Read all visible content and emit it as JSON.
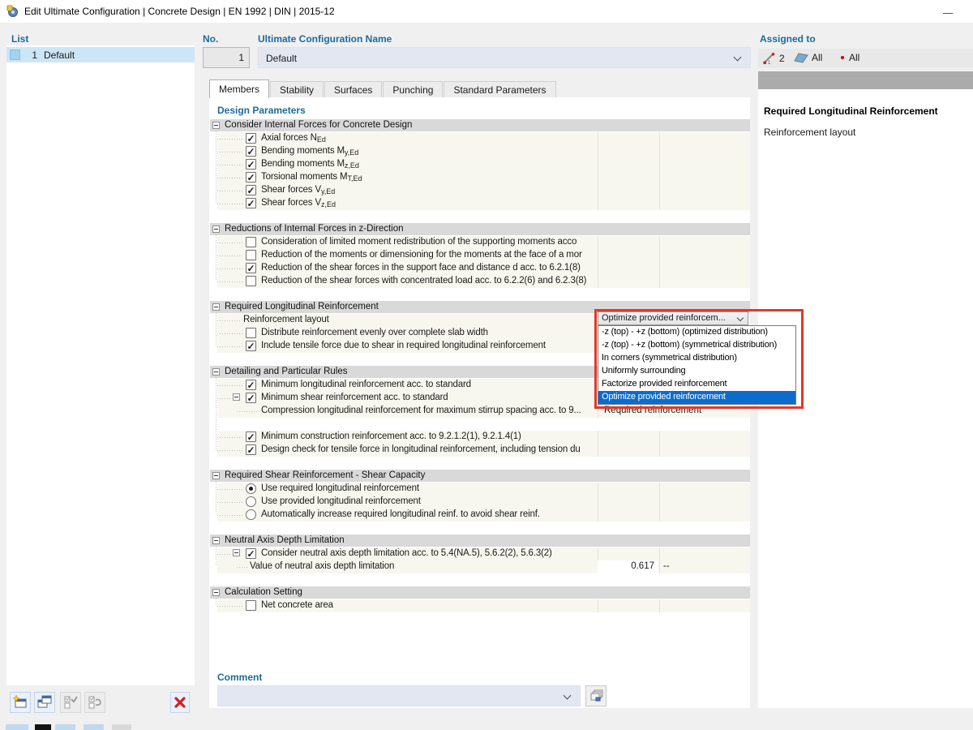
{
  "colors": {
    "accent_blue": "#1d6a9c",
    "selection_blue": "#0b6cce",
    "annotation_red": "#e0392b",
    "list_selection": "#cde6f7",
    "row_background": "#f7f7ef"
  },
  "window": {
    "title": "Edit Ultimate Configuration | Concrete Design | EN 1992 | DIN | 2015-12"
  },
  "list_panel": {
    "header": "List",
    "rows": [
      {
        "no": "1",
        "name": "Default"
      }
    ]
  },
  "config": {
    "no_label": "No.",
    "no_value": "1",
    "name_label": "Ultimate Configuration Name",
    "name_value": "Default"
  },
  "assigned": {
    "label": "Assigned to",
    "members": "2",
    "surfaces": "All",
    "points": "All"
  },
  "tabs": [
    {
      "label": "Members",
      "active": true
    },
    {
      "label": "Stability",
      "active": false
    },
    {
      "label": "Surfaces",
      "active": false
    },
    {
      "label": "Punching",
      "active": false
    },
    {
      "label": "Standard Parameters",
      "active": false
    }
  ],
  "params": {
    "header": "Design Parameters"
  },
  "right_panel": {
    "title": "Required Longitudinal Reinforcement",
    "subtitle": "Reinforcement layout"
  },
  "sections": [
    {
      "title": "Consider Internal Forces for Concrete Design",
      "rows": [
        {
          "checked": true,
          "label": "Axial forces N",
          "sub": "Ed"
        },
        {
          "checked": true,
          "label": "Bending moments M",
          "sub": "y,Ed"
        },
        {
          "checked": true,
          "label": "Bending moments M",
          "sub": "z,Ed"
        },
        {
          "checked": true,
          "label": "Torsional moments M",
          "sub": "T,Ed"
        },
        {
          "checked": true,
          "label": "Shear forces V",
          "sub": "y,Ed"
        },
        {
          "checked": true,
          "label": "Shear forces V",
          "sub": "z,Ed"
        }
      ]
    },
    {
      "title": "Reductions of Internal Forces in z-Direction",
      "rows": [
        {
          "checked": false,
          "label": "Consideration of limited moment redistribution of the supporting moments acco"
        },
        {
          "checked": false,
          "label": "Reduction of the moments or dimensioning for the moments at the face of a mor"
        },
        {
          "checked": true,
          "label": "Reduction of the shear forces in the support face and distance d acc. to 6.2.1(8)"
        },
        {
          "checked": false,
          "label": "Reduction of the shear forces with concentrated load acc. to 6.2.2(6) and 6.2.3(8)"
        }
      ]
    },
    {
      "title": "Required Longitudinal Reinforcement",
      "rows": [
        {
          "label": "Reinforcement layout"
        },
        {
          "checked": false,
          "label": "Distribute reinforcement evenly over complete slab width"
        },
        {
          "checked": true,
          "label": "Include tensile force due to shear in required longitudinal reinforcement"
        }
      ]
    },
    {
      "title": "Detailing and Particular Rules",
      "rows": [
        {
          "checked": true,
          "label": "Minimum longitudinal reinforcement acc. to standard"
        },
        {
          "checked": true,
          "label": "Minimum shear reinforcement acc. to standard"
        },
        {
          "label": "Compression longitudinal reinforcement for maximum stirrup spacing acc. to 9...",
          "value": "Required reinforcement"
        },
        {
          "checked": true,
          "label": "Minimum construction reinforcement acc. to 9.2.1.2(1), 9.2.1.4(1)"
        },
        {
          "checked": true,
          "label": "Design check for tensile force in longitudinal reinforcement, including tension du"
        }
      ]
    },
    {
      "title": "Required Shear Reinforcement - Shear Capacity",
      "rows": [
        {
          "checked": true,
          "label": "Use required longitudinal reinforcement"
        },
        {
          "checked": false,
          "label": "Use provided longitudinal reinforcement"
        },
        {
          "checked": false,
          "label": "Automatically increase required longitudinal reinf. to avoid shear reinf."
        }
      ]
    },
    {
      "title": "Neutral Axis Depth Limitation",
      "rows": [
        {
          "checked": true,
          "label": "Consider neutral axis depth limitation acc. to 5.4(NA.5), 5.6.2(2), 5.6.3(2)"
        },
        {
          "label": "Value of neutral axis depth limitation",
          "value": "0.617",
          "unit": "--"
        }
      ]
    },
    {
      "title": "Calculation Setting",
      "rows": [
        {
          "checked": false,
          "label": "Net concrete area"
        }
      ]
    }
  ],
  "dropdown": {
    "value": "Optimize provided reinforcem...",
    "items": [
      {
        "label": "-z (top) - +z (bottom) (optimized distribution)",
        "selected": false
      },
      {
        "label": "-z (top) - +z (bottom) (symmetrical distribution)",
        "selected": false
      },
      {
        "label": "In corners (symmetrical distribution)",
        "selected": false
      },
      {
        "label": "Uniformly surrounding",
        "selected": false
      },
      {
        "label": "Factorize provided reinforcement",
        "selected": false
      },
      {
        "label": "Optimize provided reinforcement",
        "selected": true
      }
    ]
  },
  "comment": {
    "label": "Comment",
    "value": ""
  }
}
